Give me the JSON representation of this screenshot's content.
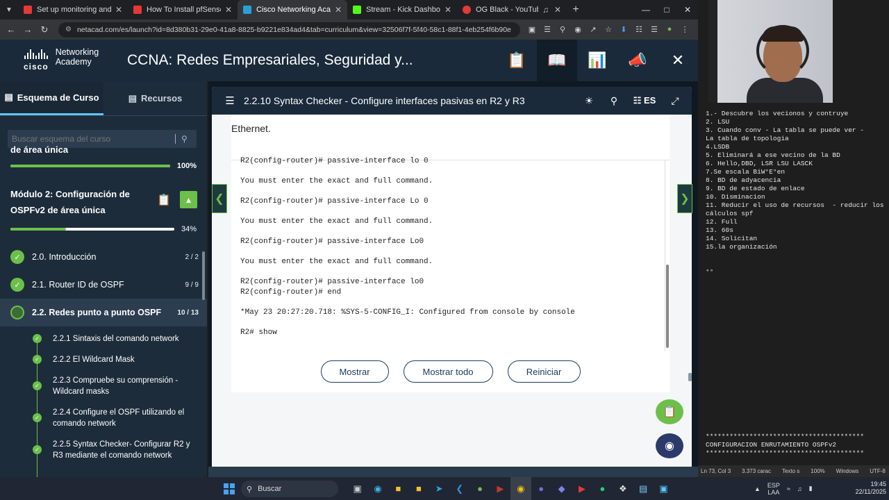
{
  "browser": {
    "tabs": [
      {
        "title": "Set up monitoring and notificati",
        "favicon_color": "#e53935",
        "active": false
      },
      {
        "title": "How To Install pfSense + Begin",
        "favicon_color": "#e53935",
        "active": false
      },
      {
        "title": "Cisco Networking Academy: CC",
        "favicon_color": "#2a9fd6",
        "active": true
      },
      {
        "title": "Stream - Kick Dashboard",
        "favicon_color": "#53fc18",
        "active": false
      },
      {
        "title": "OG Black - YouTube Music",
        "favicon_color": "#e53935",
        "active": false
      }
    ],
    "url": "netacad.com/es/launch?id=8d380b31-29e0-41a8-8825-b9221e834ad4&tab=curriculum&view=32506f7f-5f40-58c1-88f1-4eb254f6b90e"
  },
  "header": {
    "logo_word": "cisco",
    "logo_line1": "Networking",
    "logo_line2": "Academy",
    "course_title": "CCNA: Redes Empresariales, Seguridad y..."
  },
  "sidebar": {
    "tab_outline": "Esquema de Curso",
    "tab_resources": "Recursos",
    "search_placeholder": "Buscar esquema del curso",
    "prev_module": {
      "label": "de área única",
      "progress_label": "100%",
      "progress": 1.0
    },
    "module": {
      "name": "Módulo 2: Configuración de OSPFv2 de área única",
      "progress_label": "34%",
      "progress": 0.34
    },
    "sections": [
      {
        "label": "2.0. Introducción",
        "count": "2 / 2",
        "state": "done"
      },
      {
        "label": "2.1. Router ID de OSPF",
        "count": "9 / 9",
        "state": "done"
      },
      {
        "label": "2.2. Redes punto a punto OSPF",
        "count": "10 / 13",
        "state": "partial"
      }
    ],
    "subsections": [
      "2.2.1 Sintaxis del comando network",
      "2.2.2 El Wildcard Mask",
      "2.2.3 Compruebe su comprensión - Wildcard masks",
      "2.2.4 Configure el OSPF utilizando el comando network",
      "2.2.5 Syntax Checker- Configurar R2 y R3 mediante el comando network"
    ]
  },
  "activity": {
    "title": "2.2.10 Syntax Checker - Configure interfaces pasivas en R2 y R3",
    "lang": "ES",
    "intro_text": "Ethernet.",
    "terminal_lines": [
      "R2(config-router)# passive-interface lo 0",
      "",
      "You must enter the exact and full command.",
      "",
      "R2(config-router)# passive-interface Lo 0",
      "",
      "You must enter the exact and full command.",
      "",
      "R2(config-router)# passive-interface Lo0",
      "",
      "You must enter the exact and full command.",
      "",
      "R2(config-router)# passive-interface lo0",
      "R2(config-router)# end",
      "",
      "*May 23 20:27:20.718: %SYS-5-CONFIG_I: Configured from console by console",
      "",
      "R2# show"
    ],
    "buttons": [
      "Mostrar",
      "Mostrar todo",
      "Reiniciar"
    ]
  },
  "notepad": {
    "lines": [
      "1.- Descubre los vecionos y contruye",
      "2. LSU",
      "3. Cuando conv - La tabla se puede ver -",
      "La tabla de topología",
      "4.LSDB",
      "5. Eliminará a ese vecino de la BD",
      "6. Hello,DBD, LSR LSU LASCK",
      "7.Se escala BiW°E°en",
      "8. BD de adyacencia",
      "9. BD de estado de enlace",
      "10. Disminacion",
      "11. Reducir el uso de recursos  - reducir los cálculos spf",
      "12. Full",
      "13. 60s",
      "14. Solicitan",
      "15.la organización",
      "",
      "",
      "°°"
    ],
    "footer_lines": [
      "****************************************",
      "CONFIGURACION ENRUTAMIENTO OSPFv2",
      "****************************************"
    ],
    "status": [
      "Ln 73, Col 3",
      "3.373 carac",
      "Texto s",
      "100%",
      "Windows",
      "UTF-8"
    ]
  },
  "taskbar": {
    "search_label": "Buscar",
    "lang_top": "ESP",
    "lang_bottom": "LAA",
    "time": "19:45",
    "date": "22/11/2025"
  },
  "colors": {
    "accent_green": "#6cc04a",
    "header_navy": "#1a2a3a",
    "button_navy": "#1a3c63"
  }
}
